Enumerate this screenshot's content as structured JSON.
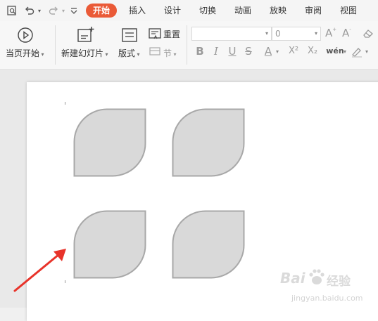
{
  "tabs": [
    {
      "label": "开始",
      "active": true
    },
    {
      "label": "插入",
      "active": false
    },
    {
      "label": "设计",
      "active": false
    },
    {
      "label": "切换",
      "active": false
    },
    {
      "label": "动画",
      "active": false
    },
    {
      "label": "放映",
      "active": false
    },
    {
      "label": "审阅",
      "active": false
    },
    {
      "label": "视图",
      "active": false
    }
  ],
  "ribbon": {
    "play_from_current": "当页开始",
    "new_slide": "新建幻灯片",
    "layout": "版式",
    "reset": "重置",
    "section": "节",
    "font_size_value": "0"
  },
  "formatting": {
    "bold": "B",
    "italic": "I",
    "underline": "U",
    "strikethrough": "S",
    "font_color": "A",
    "superscript": "X²",
    "subscript": "X₂",
    "phonetic": "wén"
  },
  "watermark": {
    "brand": "Bai",
    "brand_cn": "经验",
    "url": "jingyan.baidu.com"
  },
  "colors": {
    "accent": "#ea5a37",
    "shape_fill": "#d9d9d9",
    "shape_stroke": "#a8a8a8",
    "arrow": "#e8332a"
  }
}
